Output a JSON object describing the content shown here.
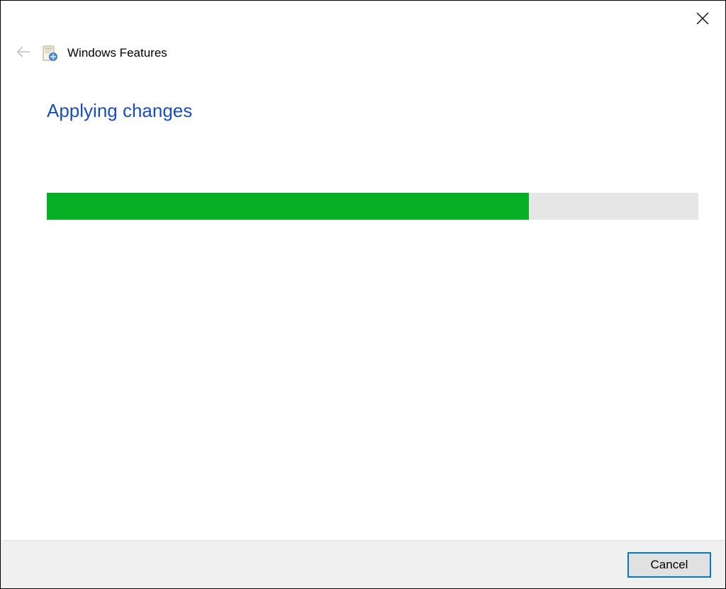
{
  "window": {
    "title": "Windows Features"
  },
  "content": {
    "heading": "Applying changes",
    "progress_percent": 74
  },
  "footer": {
    "cancel_label": "Cancel"
  },
  "colors": {
    "accent_blue": "#1a4ec0",
    "progress_green": "#06b025",
    "progress_bg": "#e6e6e6",
    "button_border": "#0078d7"
  }
}
